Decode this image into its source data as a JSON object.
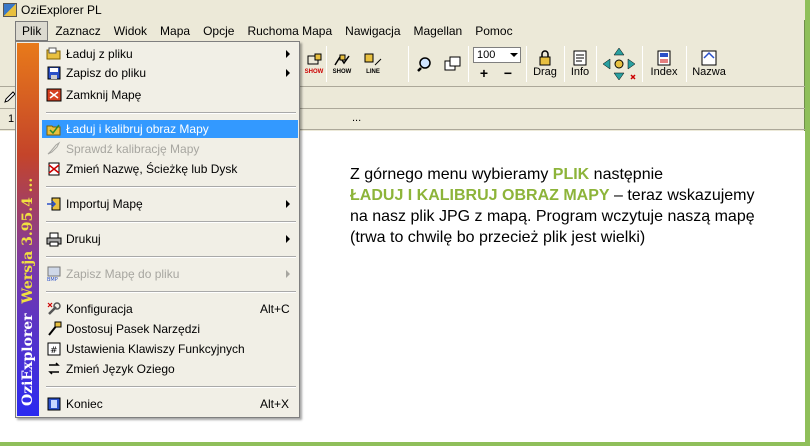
{
  "window": {
    "title": "OziExplorer PL"
  },
  "menubar": [
    "Plik",
    "Zaznacz",
    "Widok",
    "Mapa",
    "Opcje",
    "Ruchoma Mapa",
    "Nawigacja",
    "Magellan",
    "Pomoc"
  ],
  "toolbar": {
    "zoom_value": "100",
    "drag_label": "Drag",
    "info_label": "Info",
    "index_label": "Index",
    "nazwa_label": "Nazwa",
    "show_label": "SHOW",
    "line_label": "LINE"
  },
  "ruler": {
    "left": "1",
    "dots": "..."
  },
  "plik_menu": {
    "sidebar": {
      "name": "OziExplorer",
      "version": "Wersja 3.95.4 ..."
    },
    "items": [
      {
        "label": "Ładuj z pliku",
        "submenu": true,
        "icon": "open-folder-icon"
      },
      {
        "label": "Zapisz do pliku",
        "submenu": true,
        "icon": "save-icon"
      },
      {
        "label": "Zamknij Mapę",
        "icon": "close-map-icon"
      },
      {
        "label": "Ładuj i kalibruj obraz Mapy",
        "highlighted": true,
        "icon": "load-calibrate-icon"
      },
      {
        "label": "Sprawdź kalibrację Mapy",
        "disabled": true,
        "icon": "check-calibration-icon"
      },
      {
        "label": "Zmień Nazwę, Ścieżkę lub Dysk",
        "icon": "rename-icon"
      },
      {
        "label": "Importuj Mapę",
        "submenu": true,
        "icon": "import-icon"
      },
      {
        "label": "Drukuj",
        "submenu": true,
        "icon": "print-icon"
      },
      {
        "label": "Zapisz Mapę do pliku",
        "submenu": true,
        "disabled": true,
        "icon": "bmp-icon"
      },
      {
        "label": "Konfiguracja",
        "shortcut": "Alt+C",
        "icon": "config-icon"
      },
      {
        "label": "Dostosuj Pasek Narzędzi",
        "icon": "toolbar-icon"
      },
      {
        "label": "Ustawienia Klawiszy Funkcyjnych",
        "icon": "keys-icon"
      },
      {
        "label": "Zmień Język Oziego",
        "icon": "language-icon"
      },
      {
        "label": "Koniec",
        "shortcut": "Alt+X",
        "icon": "exit-icon"
      }
    ]
  },
  "instruction": {
    "p1": "Z górnego menu wybieramy ",
    "plik": "PLIK",
    "p2": " następnie ",
    "laduj": "ŁADUJ I KALIBRUJ OBRAZ MAPY",
    "p3": " – teraz wskazujemy na nasz plik JPG z mapą. Program wczytuje naszą mapę (trwa to chwilę bo przecież plik jest wielki)",
    "highlight_color": "#8db43a"
  }
}
